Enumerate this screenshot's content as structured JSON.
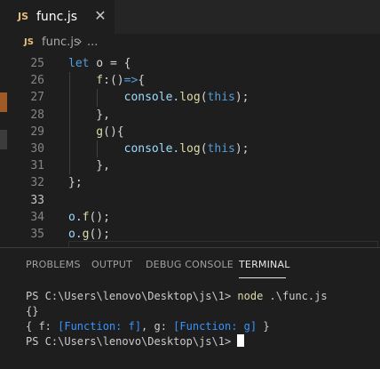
{
  "tab": {
    "badge": "JS",
    "filename": "func.js",
    "close": "✕"
  },
  "breadcrumb": {
    "badge": "JS",
    "file": "func.js",
    "separator": "›",
    "more": "..."
  },
  "editor": {
    "lines": [
      {
        "number": "25",
        "tokens": [
          {
            "t": "let",
            "c": "k"
          },
          {
            "t": " o = {",
            "c": "w"
          }
        ]
      },
      {
        "number": "26",
        "tokens": [
          {
            "t": "    f",
            "c": "f"
          },
          {
            "t": ":()",
            "c": "w"
          },
          {
            "t": "=>",
            "c": "k"
          },
          {
            "t": "{",
            "c": "w"
          }
        ]
      },
      {
        "number": "27",
        "tokens": [
          {
            "t": "        console.",
            "c": "p"
          },
          {
            "t": "log",
            "c": "f"
          },
          {
            "t": "(",
            "c": "w"
          },
          {
            "t": "this",
            "c": "k"
          },
          {
            "t": ");",
            "c": "w"
          }
        ]
      },
      {
        "number": "28",
        "tokens": [
          {
            "t": "    },",
            "c": "w"
          }
        ]
      },
      {
        "number": "29",
        "tokens": [
          {
            "t": "    g",
            "c": "f"
          },
          {
            "t": "(){",
            "c": "w"
          }
        ]
      },
      {
        "number": "30",
        "tokens": [
          {
            "t": "        console.",
            "c": "p"
          },
          {
            "t": "log",
            "c": "f"
          },
          {
            "t": "(",
            "c": "w"
          },
          {
            "t": "this",
            "c": "k"
          },
          {
            "t": ");",
            "c": "w"
          }
        ]
      },
      {
        "number": "31",
        "tokens": [
          {
            "t": "    },",
            "c": "w"
          }
        ]
      },
      {
        "number": "32",
        "tokens": [
          {
            "t": "};",
            "c": "w"
          }
        ]
      },
      {
        "number": "33",
        "tokens": [
          {
            "t": "",
            "c": "w"
          }
        ]
      },
      {
        "number": "34",
        "tokens": [
          {
            "t": "o.",
            "c": "p"
          },
          {
            "t": "f",
            "c": "f"
          },
          {
            "t": "();",
            "c": "w"
          }
        ]
      },
      {
        "number": "35",
        "tokens": [
          {
            "t": "o.",
            "c": "p"
          },
          {
            "t": "g",
            "c": "f"
          },
          {
            "t": "();",
            "c": "w"
          }
        ]
      }
    ],
    "current_line": "33"
  },
  "panel": {
    "tabs": [
      "PROBLEMS",
      "OUTPUT",
      "DEBUG CONSOLE",
      "TERMINAL"
    ],
    "active_tab": "TERMINAL"
  },
  "terminal": {
    "prompt": "PS C:\\Users\\lenovo\\Desktop\\js\\1>",
    "command_node": "node",
    "command_arg": " .\\func.js",
    "output1": "{}",
    "output2_a": "{ f: ",
    "output2_f": "[Function: f]",
    "output2_b": ", g: ",
    "output2_g": "[Function: g]",
    "output2_c": " }"
  },
  "colors": {
    "background": "#1e1e1e",
    "keyword": "#569cd6",
    "function": "#dcdcaa",
    "property": "#9cdcfe",
    "js_badge": "#e5c07b"
  }
}
